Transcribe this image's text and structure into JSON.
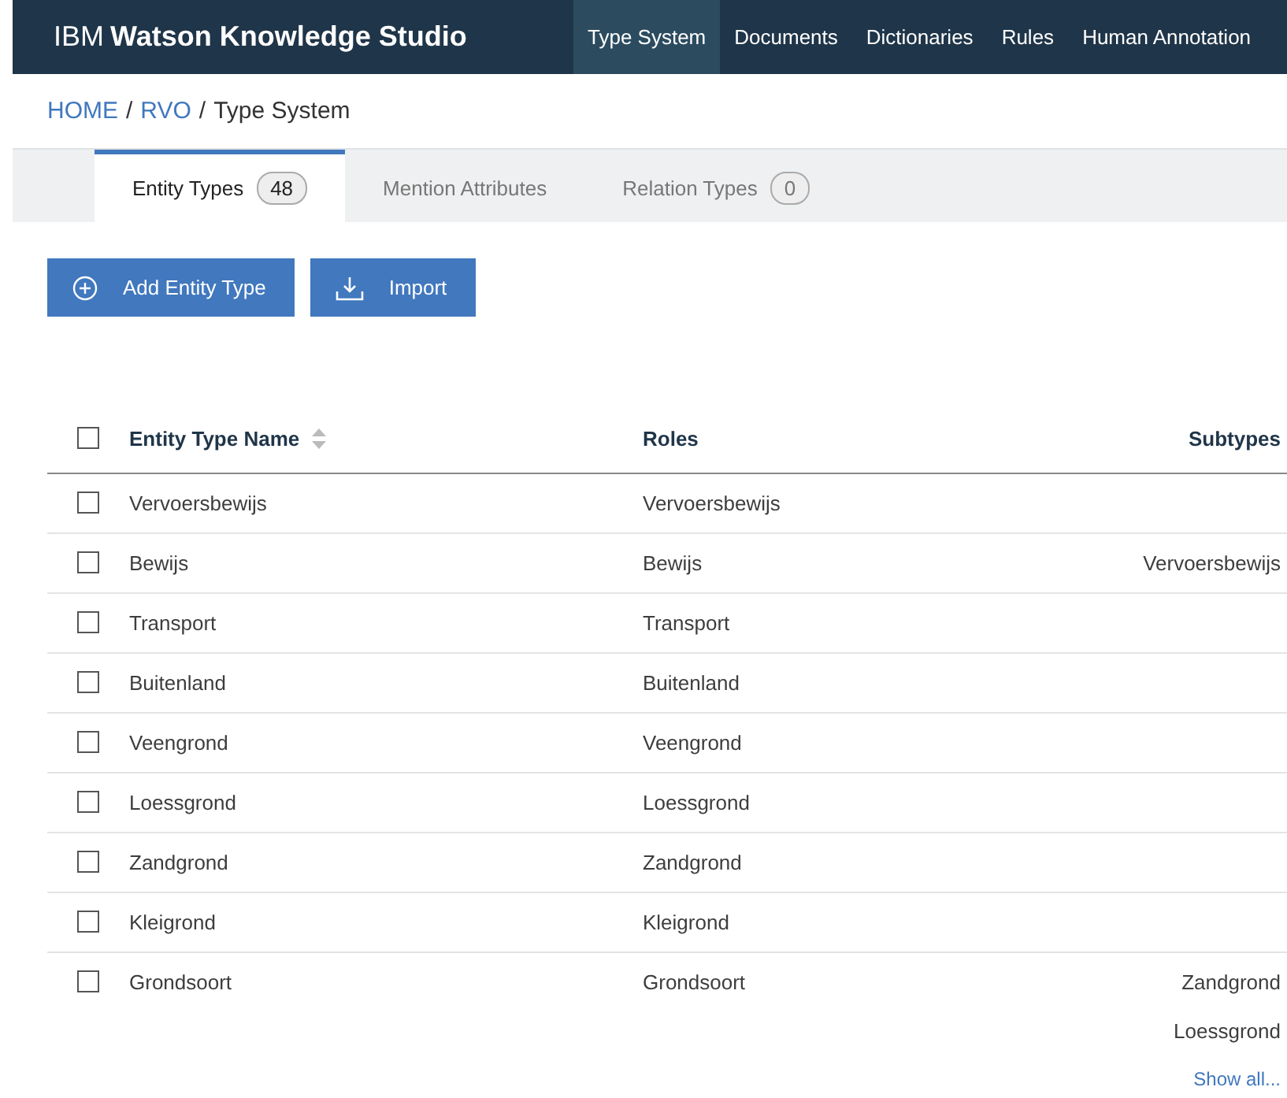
{
  "header": {
    "brand_prefix": "IBM",
    "brand_name": "Watson Knowledge Studio",
    "nav": [
      {
        "label": "Type System",
        "selected": true
      },
      {
        "label": "Documents",
        "selected": false
      },
      {
        "label": "Dictionaries",
        "selected": false
      },
      {
        "label": "Rules",
        "selected": false
      },
      {
        "label": "Human Annotation",
        "selected": false
      }
    ]
  },
  "breadcrumb": [
    {
      "label": "HOME",
      "kind": "link"
    },
    {
      "label": "/",
      "kind": "separator"
    },
    {
      "label": "RVO",
      "kind": "link"
    },
    {
      "label": "/",
      "kind": "separator"
    },
    {
      "label": "Type System",
      "kind": "current"
    }
  ],
  "tabs": [
    {
      "label": "Entity Types",
      "count": "48",
      "selected": true
    },
    {
      "label": "Mention Attributes",
      "selected": false
    },
    {
      "label": "Relation Types",
      "count": "0",
      "selected": false
    }
  ],
  "buttons": [
    {
      "label": "Add Entity Type",
      "kind": "add"
    },
    {
      "label": "Import",
      "kind": "import"
    }
  ],
  "table": {
    "select_all_checked": false,
    "columns": [
      "Entity Type Name",
      "Roles",
      "Subtypes"
    ],
    "rows": [
      {
        "checked": false,
        "name": "Vervoersbewijs",
        "roles": "Vervoersbewijs",
        "subtypes": []
      },
      {
        "checked": false,
        "name": "Bewijs",
        "roles": "Bewijs",
        "subtypes": [
          "Vervoersbewijs"
        ]
      },
      {
        "checked": false,
        "name": "Transport",
        "roles": "Transport",
        "subtypes": []
      },
      {
        "checked": false,
        "name": "Buitenland",
        "roles": "Buitenland",
        "subtypes": []
      },
      {
        "checked": false,
        "name": "Veengrond",
        "roles": "Veengrond",
        "subtypes": []
      },
      {
        "checked": false,
        "name": "Loessgrond",
        "roles": "Loessgrond",
        "subtypes": []
      },
      {
        "checked": false,
        "name": "Zandgrond",
        "roles": "Zandgrond",
        "subtypes": []
      },
      {
        "checked": false,
        "name": "Kleigrond",
        "roles": "Kleigrond",
        "subtypes": []
      },
      {
        "checked": false,
        "name": "Grondsoort",
        "roles": "Grondsoort",
        "subtypes": [
          "Zandgrond",
          "Loessgrond"
        ],
        "show_all": "Show all..."
      }
    ]
  }
}
